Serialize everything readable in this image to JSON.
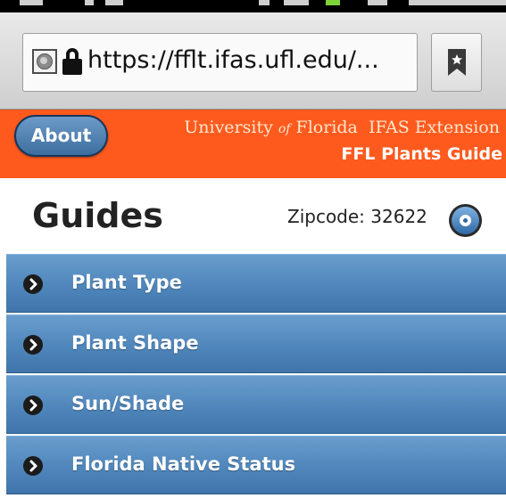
{
  "browser": {
    "url": "https://fflt.ifas.ufl.edu/...",
    "site_icon": "globe-icon",
    "security_icon": "lock-icon",
    "bookmark_icon": "bookmark-icon"
  },
  "header": {
    "about_label": "About",
    "org_prefix": "University ",
    "org_of": "of",
    "org_suffix": " Florida  IFAS Extension",
    "guide_title": "FFL Plants Guide",
    "accent_color": "#ff5a1e"
  },
  "guides": {
    "title": "Guides",
    "zipcode_label": "Zipcode: 32622",
    "settings_icon": "settings-icon"
  },
  "list": {
    "item_icon": "chevron-right-icon",
    "item_color": "#4f86bb",
    "items": [
      {
        "label": "Plant Type"
      },
      {
        "label": "Plant Shape"
      },
      {
        "label": "Sun/Shade"
      },
      {
        "label": "Florida Native Status"
      }
    ]
  }
}
